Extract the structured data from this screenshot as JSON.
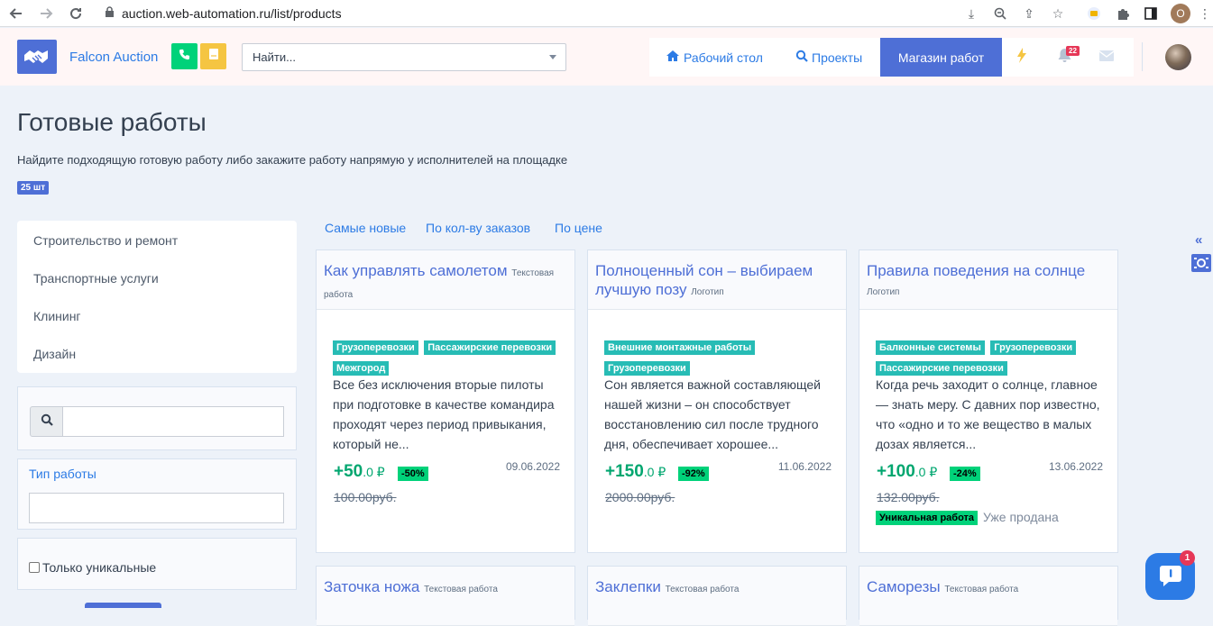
{
  "browser": {
    "url": "auction.web-automation.ru/list/products",
    "profile_initial": "O"
  },
  "navbar": {
    "brand": "Falcon Auction",
    "search_placeholder": "Найти...",
    "links": [
      {
        "label": "Рабочий стол",
        "icon": "home-icon"
      },
      {
        "label": "Проекты",
        "icon": "search-icon"
      }
    ],
    "shop_button": "Магазин работ",
    "notifications_count": "22",
    "colors": {
      "primary": "#4e6fd6",
      "phone": "#00d27a",
      "note": "#f5c542"
    }
  },
  "page": {
    "title": "Готовые работы",
    "lead": "Найдите подходящую готовую работу либо закажите работу напрямую у исполнителей на площадке",
    "count": "25 шт"
  },
  "sidebar": {
    "categories": [
      "Строительство и ремонт",
      "Транспортные услуги",
      "Клининг",
      "Дизайн"
    ],
    "type_label": "Тип работы",
    "unique_only_label": "Только уникальные"
  },
  "sort": [
    "Самые новые",
    "По кол-ву заказов",
    "По цене"
  ],
  "products": [
    {
      "title": "Как управлять самолетом",
      "type": "Текстовая работа",
      "tags": [
        "Грузоперевозки",
        "Пассажирские перевозки",
        "Межгород"
      ],
      "description": "Все без исключения вторые пилоты при подготовке в качестве командира проходят через период привыкания, который не...",
      "price_main": "+50",
      "price_frac": ".0 ₽",
      "discount": "-50%",
      "date": "09.06.2022",
      "old_price": "100.00руб."
    },
    {
      "title": "Полноценный сон – выбираем лучшую позу",
      "type": "Логотип",
      "tags": [
        "Внешние монтажные работы",
        "Грузоперевозки"
      ],
      "description": "Сон является важной составляющей нашей жизни – он способствует восстановлению сил после трудного дня, обеспечивает хорошее...",
      "price_main": "+150",
      "price_frac": ".0 ₽",
      "discount": "-92%",
      "date": "11.06.2022",
      "old_price": "2000.00руб."
    },
    {
      "title": "Правила поведения на солнце",
      "type": "Логотип",
      "tags": [
        "Балконные системы",
        "Грузоперевозки",
        "Пассажирские перевозки"
      ],
      "description": "Когда речь заходит о солнце, главное — знать меру. С давних пор известно, что «одно и то же вещество в малых дозах является...",
      "price_main": "+100",
      "price_frac": ".0 ₽",
      "discount": "-24%",
      "date": "13.06.2022",
      "old_price": "132.00руб.",
      "unique_badge": "Уникальная работа",
      "status": "Уже продана"
    },
    {
      "title": "Заточка ножа",
      "type": "Текстовая работа"
    },
    {
      "title": "Заклепки",
      "type": "Текстовая работа"
    },
    {
      "title": "Саморезы",
      "type": "Текстовая работа"
    }
  ],
  "chat": {
    "badge": "1"
  }
}
